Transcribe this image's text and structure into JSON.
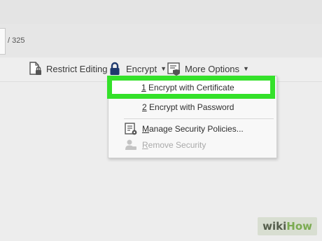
{
  "navigation": {
    "page_total": "/ 325"
  },
  "toolbar": {
    "restrict_editing_label": "Restrict Editing",
    "encrypt_label": "Encrypt",
    "more_options_label": "More Options"
  },
  "encrypt_menu": {
    "items": [
      {
        "mnemonic": "1",
        "label": " Encrypt with Certificate",
        "state": "highlighted"
      },
      {
        "mnemonic": "2",
        "label": " Encrypt with Password",
        "state": "enabled"
      },
      {
        "mnemonic": "M",
        "label": "anage Security Policies...",
        "state": "enabled"
      },
      {
        "mnemonic": "R",
        "label": "emove Security",
        "state": "disabled"
      }
    ]
  },
  "watermark": {
    "part1": "wiki",
    "part2": "How"
  },
  "colors": {
    "highlight_border": "#34e12a",
    "lock_icon": "#1f3a6e",
    "watermark_green": "#7bab51"
  }
}
